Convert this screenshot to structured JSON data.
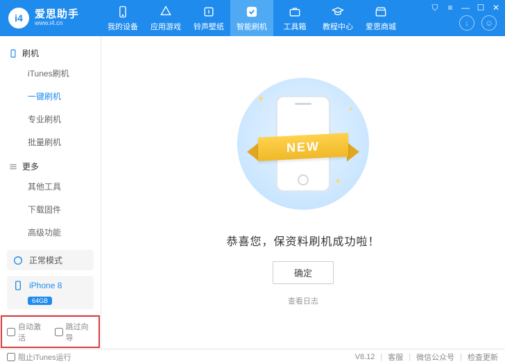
{
  "app": {
    "title": "爱思助手",
    "url": "www.i4.cn"
  },
  "nav": [
    {
      "label": "我的设备"
    },
    {
      "label": "应用游戏"
    },
    {
      "label": "铃声壁纸"
    },
    {
      "label": "智能刷机"
    },
    {
      "label": "工具箱"
    },
    {
      "label": "教程中心"
    },
    {
      "label": "爱思商城"
    }
  ],
  "sidebar": {
    "section1": {
      "title": "刷机"
    },
    "section2": {
      "title": "更多"
    },
    "items1": [
      {
        "label": "iTunes刷机"
      },
      {
        "label": "一键刷机"
      },
      {
        "label": "专业刷机"
      },
      {
        "label": "批量刷机"
      }
    ],
    "items2": [
      {
        "label": "其他工具"
      },
      {
        "label": "下载固件"
      },
      {
        "label": "高级功能"
      }
    ],
    "status": "正常模式",
    "device": {
      "name": "iPhone 8",
      "storage": "64GB"
    },
    "cb1": "自动激活",
    "cb2": "跳过向导"
  },
  "main": {
    "ribbon": "NEW",
    "headline": "恭喜您，保资料刷机成功啦！",
    "ok": "确定",
    "log": "查看日志"
  },
  "statusbar": {
    "block_itunes": "阻止iTunes运行",
    "version": "V8.12",
    "s1": "客服",
    "s2": "微信公众号",
    "s3": "检查更新"
  }
}
